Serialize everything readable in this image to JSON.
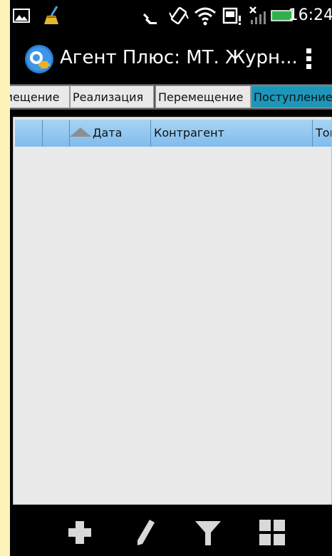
{
  "status_bar": {
    "time": "16:24",
    "icons": [
      "picture-icon",
      "broom-icon",
      "missed-call-icon",
      "vibrate-icon",
      "wifi-icon",
      "sd-card-icon",
      "no-signal-icon",
      "battery-icon"
    ]
  },
  "action_bar": {
    "title": "Агент Плюс: МТ. Журн...",
    "logo": "app-logo-icon",
    "menu": "overflow-menu-icon"
  },
  "tabs": [
    {
      "label": "Перемещение",
      "active": false
    },
    {
      "label": "Реализация",
      "active": false
    },
    {
      "label": "Перемещение",
      "active": false
    },
    {
      "label": "Поступление",
      "active": true
    }
  ],
  "grid": {
    "columns": [
      "",
      "",
      "Дата",
      "Контрагент",
      "Товары"
    ],
    "sort_column": "Дата",
    "rows": []
  },
  "toolbar": {
    "buttons": [
      "add-icon",
      "edit-icon",
      "filter-icon",
      "grid-view-icon"
    ]
  },
  "colors": {
    "page_background": "#fdf3b8",
    "active_tab": "#1c97b9",
    "grid_header": "#8cc6ef"
  }
}
